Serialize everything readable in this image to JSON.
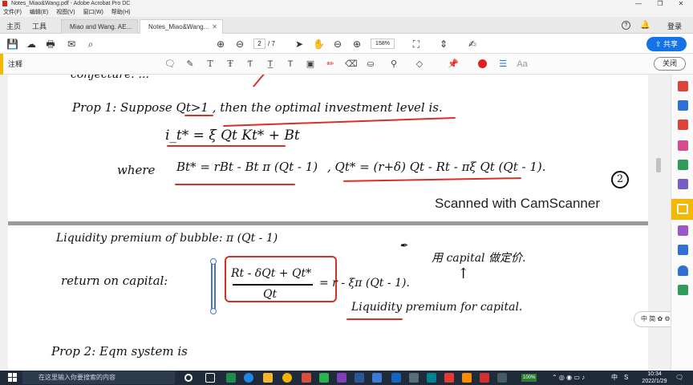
{
  "window": {
    "title": "Notes_Miao&Wang.pdf - Adobe Acrobat Pro DC",
    "controls": [
      "—",
      "❐",
      "✕"
    ]
  },
  "menu": [
    "文件(F)",
    "编辑(E)",
    "视图(V)",
    "窗口(W)",
    "帮助(H)"
  ],
  "tabs": {
    "home": "主页",
    "tools": "工具",
    "docs": [
      "Miao and Wang. AE...",
      "Notes_Miao&Wang..."
    ],
    "help": "?",
    "login": "登录"
  },
  "toolbar": {
    "page_current": "2",
    "page_total": "/ 7",
    "zoom": "158%",
    "share": "共享"
  },
  "comment_bar": {
    "label": "注释",
    "close": "关闭"
  },
  "document": {
    "page1": {
      "line0": "conjecture: ...",
      "prop1": "Prop 1:  Suppose  Qt>1  , then the optimal investment level is.",
      "formula1": "i_t* =  ξ Qt Kt* + Bt",
      "where": "where",
      "formula2": "Bt* =  rBt - Bt π (Qt - 1)",
      "formula3": ", Qt* = (r+δ) Qt - Rt - πξ Qt (Qt - 1).",
      "circled_number": "2",
      "watermark": "Scanned with CamScanner"
    },
    "page2": {
      "liquidity": "Liquidity  premium of bubble:  π (Qt - 1)",
      "return_label": "return on capital:",
      "fraction_num": "Rt - δQt + Qt*",
      "fraction_den": "Qt",
      "equals": "=  r - ξπ (Qt - 1).",
      "note_cn": "用 capital 做定价.",
      "arrow": "↑",
      "liquidity_cap": "Liquidity  premium  for capital.",
      "prop2": "Prop 2:    Eqm  system  is"
    },
    "ime_widget": "中 简 ✿ ⚙"
  },
  "taskbar": {
    "search_placeholder": "在这里输入你要搜索的内容",
    "time": "10:34",
    "date": "2022/1/29",
    "battery": "100%",
    "ime": "中",
    "lang": "S"
  },
  "colors": {
    "accent": "#1473e6",
    "annotation_red": "#d93025",
    "comment_yellow": "#f5b800",
    "taskbar": "#1f2a3a"
  }
}
